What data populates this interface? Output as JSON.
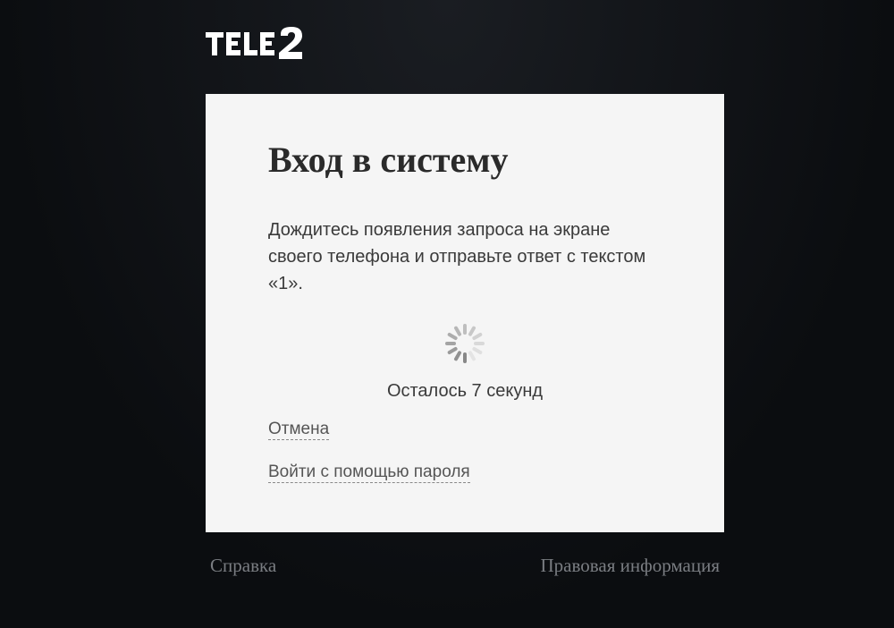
{
  "brand": "TELE2",
  "card": {
    "title": "Вход в систему",
    "instruction": "Дождитесь появления запроса на экране своего телефона и отправьте ответ с текстом «1».",
    "countdown": "Осталось 7 секунд",
    "cancel_label": "Отмена",
    "password_login_label": "Войти с помощью пароля"
  },
  "footer": {
    "help_label": "Справка",
    "legal_label": "Правовая информация"
  }
}
